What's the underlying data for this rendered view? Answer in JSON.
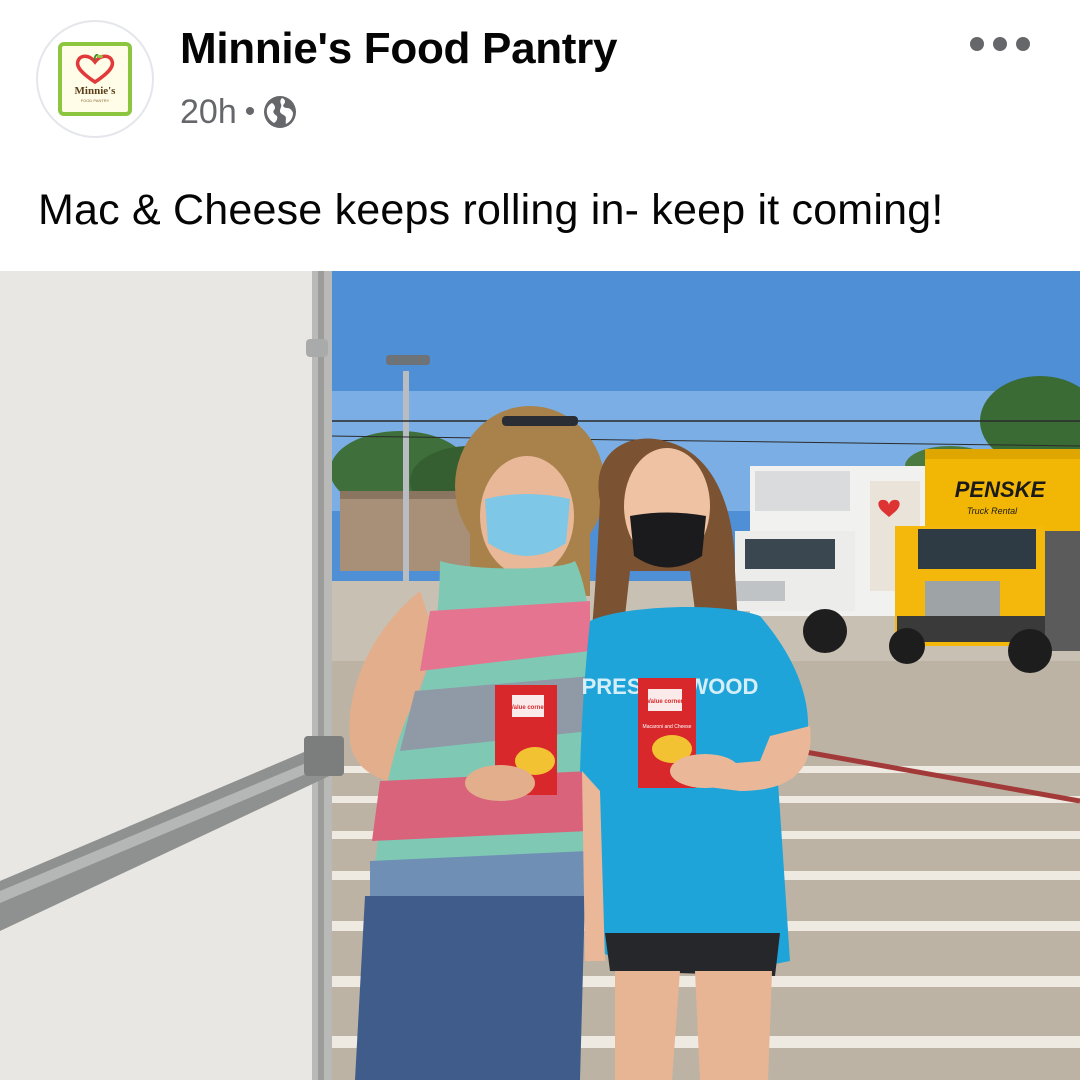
{
  "post": {
    "page_name": "Minnie's Food Pantry",
    "timestamp": "20h",
    "separator": "•",
    "privacy_icon": "globe-icon",
    "more_icon": "more-options-icon",
    "caption": "Mac & Cheese keeps rolling in- keep it coming!",
    "avatar": {
      "logo_text": "Minnie's",
      "logo_subtext": "FOOD PANTRY"
    }
  },
  "photo": {
    "signs": {
      "truck": "PENSKE",
      "truck_sub": "Truck Rental",
      "box_brand": "Value corner",
      "box_product": "Macaroni and Cheese",
      "shirt": "PRESTONWOOD"
    }
  },
  "colors": {
    "secondary_text": "#65676b",
    "logo_green": "#8cc63f",
    "logo_heart": "#e23a3a",
    "sky": "#4f8fd6",
    "penske_yellow": "#f2b705",
    "shirt_blue": "#1ea4d8"
  }
}
